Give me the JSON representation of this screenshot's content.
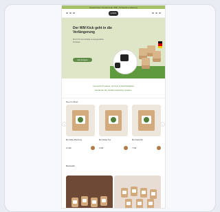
{
  "topbar": {
    "text": "Kostenloser Versand ab 39€ | Schnelle Lieferung"
  },
  "header": {
    "logo": "LOGO"
  },
  "hero": {
    "title": "Der WM Kick geht in die Verlängerung",
    "subtitle": "Mit 15 Prozent Rabatt auf ausgewählte Produkte...",
    "cta": "Jetzt shoppen"
  },
  "promo": {
    "line1": "Gesunde Produkte, Genuss & Nachhaltigkeit",
    "line2": "Entdecke die Vielfalt natürlicher Zutaten"
  },
  "sections": {
    "new": "Neu im Shop",
    "best": "Bestseller"
  },
  "products": [
    {
      "name": "Bio Kaffee Mischung",
      "price": "12,90€"
    },
    {
      "name": "Bio Kräuter Tee",
      "price": "9,90€"
    },
    {
      "name": "Bio Snack Mix",
      "price": "7,50€"
    }
  ],
  "icons": {
    "prev": "chevron-left-icon",
    "next": "chevron-right-icon"
  }
}
